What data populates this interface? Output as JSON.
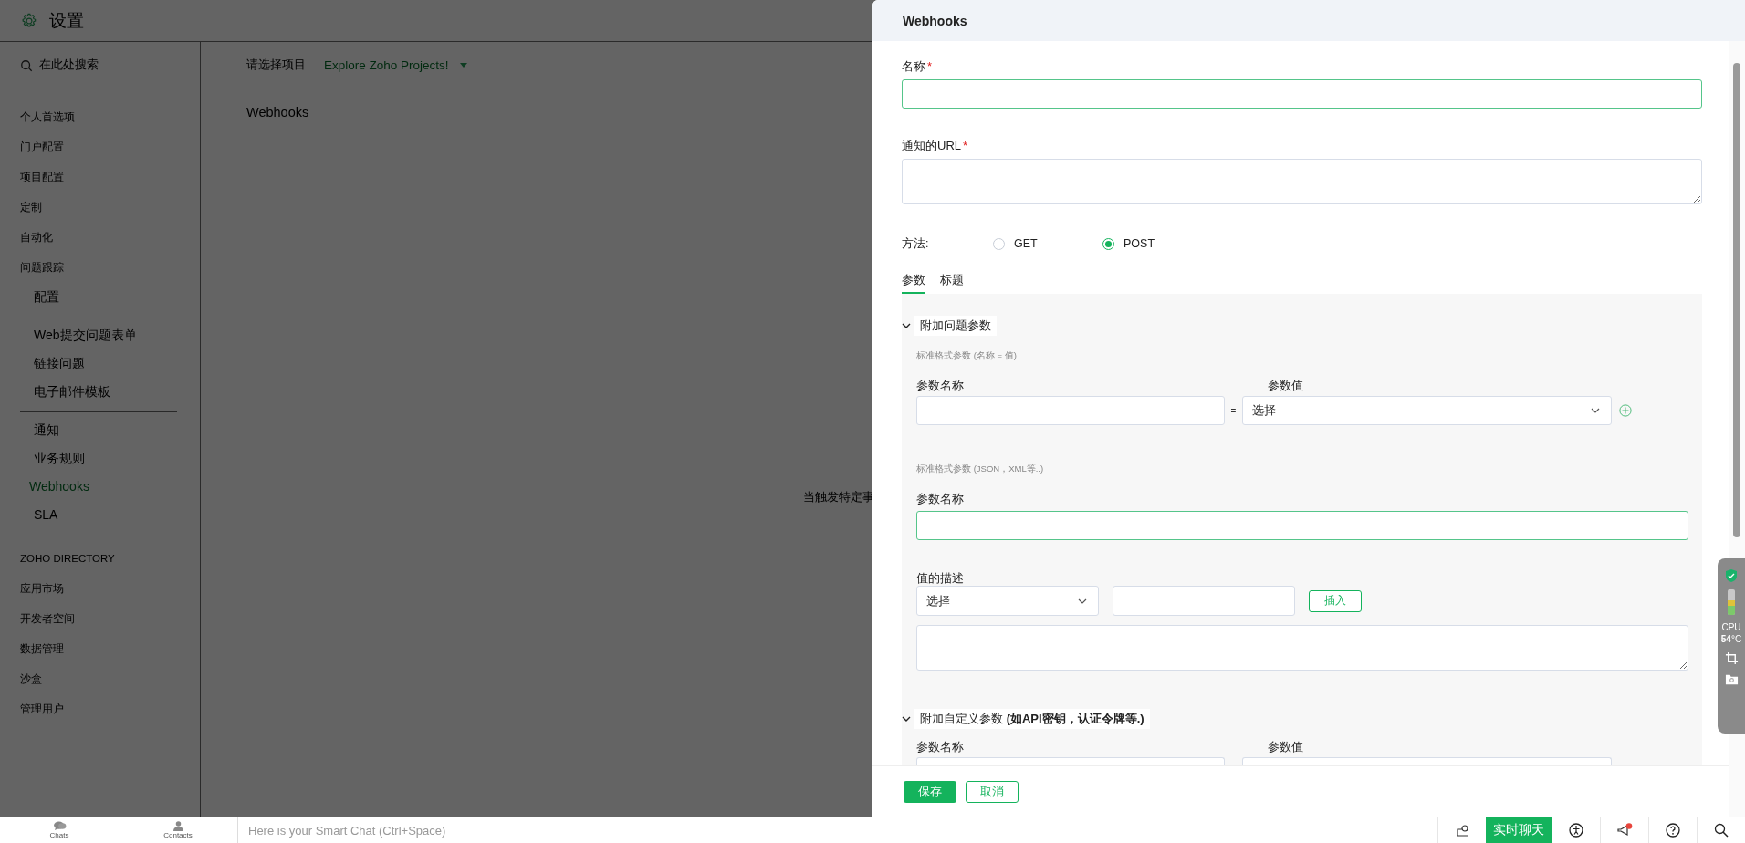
{
  "settings": {
    "title": "设置",
    "search": {
      "placeholder": "在此处搜索"
    },
    "sidebar": {
      "items": [
        {
          "label": "个人首选项",
          "kind": "item",
          "selected": false
        },
        {
          "label": "门户配置",
          "kind": "item",
          "selected": false
        },
        {
          "label": "项目配置",
          "kind": "item",
          "selected": false
        },
        {
          "label": "定制",
          "kind": "item",
          "selected": false
        },
        {
          "label": "自动化",
          "kind": "item",
          "selected": false
        },
        {
          "label": "问题跟踪",
          "kind": "item",
          "selected": false,
          "children": [
            {
              "items": [
                {
                  "label": "配置",
                  "selected": false
                }
              ]
            },
            {
              "items": [
                {
                  "label": "Web提交问题表单",
                  "selected": false
                },
                {
                  "label": "链接问题",
                  "selected": false
                },
                {
                  "label": "电子邮件模板",
                  "selected": false
                }
              ]
            },
            {
              "items": [
                {
                  "label": "通知",
                  "selected": false
                },
                {
                  "label": "业务规则",
                  "selected": false
                },
                {
                  "label": "Webhooks",
                  "selected": true
                },
                {
                  "label": "SLA",
                  "selected": false
                }
              ]
            }
          ]
        },
        {
          "label": "ZOHO DIRECTORY",
          "kind": "heading"
        },
        {
          "label": "应用市场",
          "kind": "item",
          "selected": false
        },
        {
          "label": "开发者空间",
          "kind": "item",
          "selected": false
        },
        {
          "label": "数据管理",
          "kind": "item",
          "selected": false
        },
        {
          "label": "沙盒",
          "kind": "item",
          "selected": false
        },
        {
          "label": "管理用户",
          "kind": "item",
          "selected": false
        }
      ]
    },
    "project_bar": {
      "label": "请选择项目",
      "project": "Explore Zoho Projects!"
    },
    "heading": "Webhooks",
    "message": "当触发特定事"
  },
  "panel": {
    "title": "Webhooks",
    "name_field": {
      "label": "名称",
      "required_mark": "*"
    },
    "url_field": {
      "label": "通知的URL",
      "required_mark": "*"
    },
    "method": {
      "label": "方法:",
      "options": [
        {
          "label": "GET",
          "selected": false
        },
        {
          "label": "POST",
          "selected": true
        }
      ]
    },
    "tabs": [
      {
        "label": "参数",
        "selected": true
      },
      {
        "label": "标题",
        "selected": false
      }
    ],
    "issue_params": {
      "title": "附加问题参数",
      "expanded": true,
      "standard_hint": "标准格式参数 (名称 = 值)",
      "name_label": "参数名称",
      "value_label": "参数值",
      "equals": "=",
      "value_select": "选择",
      "custom_hint": "标准格式参数 (JSON，XML等..)",
      "custom_name_label": "参数名称",
      "desc_label": "值的描述",
      "desc_select": "选择",
      "insert_button": "插入"
    },
    "custom_params": {
      "title": "附加自定义参数  **(如API密钥，认证令牌等.)**",
      "expanded": true,
      "name_label": "参数名称",
      "value_label": "参数值"
    },
    "buttons": {
      "save": "保存",
      "cancel": "取消"
    }
  },
  "monitor": {
    "label": "CPU",
    "value": "54",
    "unit": "°C"
  },
  "chat_bar": {
    "tabs": [
      {
        "label": "Chats",
        "kind": "chats"
      },
      {
        "label": "Contacts",
        "kind": "contacts"
      }
    ],
    "placeholder": "Here is your Smart Chat (Ctrl+Space)",
    "live_chat": "实时聊天",
    "has_notification": true
  }
}
